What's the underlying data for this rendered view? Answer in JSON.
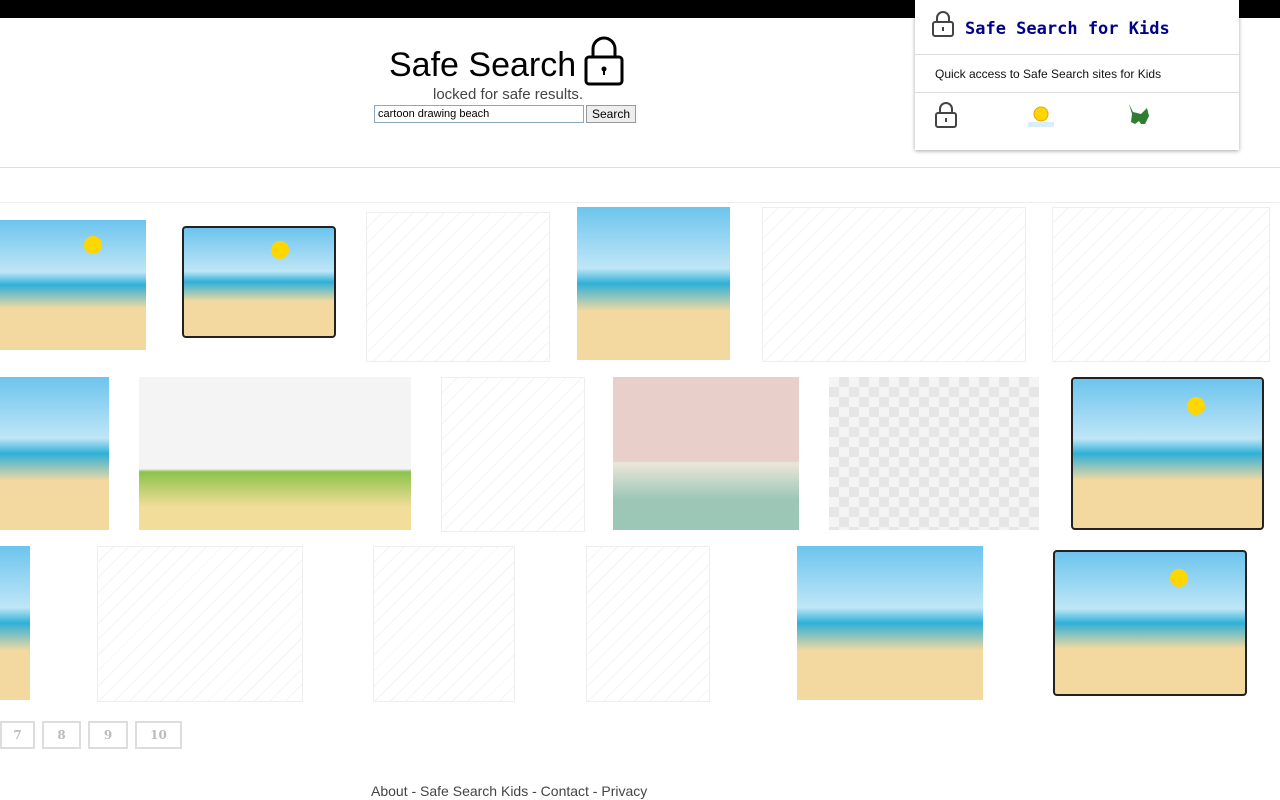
{
  "header": {
    "title": "Safe Search",
    "tagline": "locked for safe results.",
    "search_value": "cartoon drawing beach",
    "search_button": "Search"
  },
  "results": [
    {
      "style": "beach sun"
    },
    {
      "style": "beach framed sun"
    },
    {
      "style": "sketch"
    },
    {
      "style": "beach"
    },
    {
      "style": "sketch"
    },
    {
      "style": "sketch"
    },
    {
      "style": "beach"
    },
    {
      "style": "palm"
    },
    {
      "style": "sketch"
    },
    {
      "style": "pink"
    },
    {
      "style": "checker"
    },
    {
      "style": "beach framed sun"
    },
    {
      "style": "beach"
    },
    {
      "style": "sketch"
    },
    {
      "style": "sketch"
    },
    {
      "style": "sketch"
    },
    {
      "style": "beach"
    },
    {
      "style": "beach framed sun"
    }
  ],
  "pagination": [
    "7",
    "8",
    "9",
    "10"
  ],
  "footer": {
    "about": "About",
    "sep": " - ",
    "kids": "Safe Search Kids",
    "contact": "Contact",
    "privacy": "Privacy"
  },
  "popup": {
    "title": "Safe Search for Kids",
    "description": "Quick access to Safe Search sites for Kids",
    "shortcuts": [
      "lock-icon",
      "sun-icon",
      "dinosaur-icon"
    ]
  },
  "colors": {
    "popup_title": "#00008b"
  }
}
